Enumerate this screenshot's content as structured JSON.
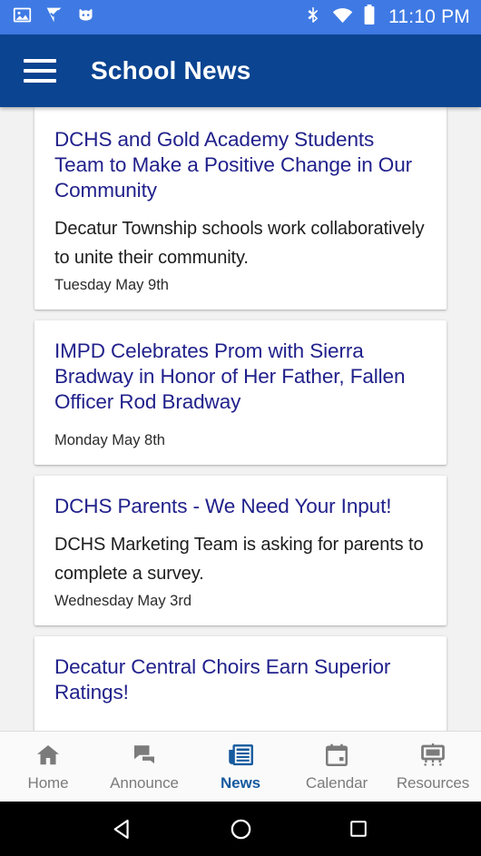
{
  "status_bar": {
    "background": "#3f7ae4",
    "clock": "11:10 PM",
    "left_icons": [
      {
        "name": "screenshot-image-icon"
      },
      {
        "name": "task-checkmark-icon"
      },
      {
        "name": "cyanogenmod-robot-icon"
      }
    ],
    "right_icons": [
      {
        "name": "bluetooth-icon"
      },
      {
        "name": "wifi-icon"
      },
      {
        "name": "battery-full-icon"
      }
    ]
  },
  "app_bar": {
    "background": "#0b4491",
    "title": "School News",
    "menu_icon": "hamburger-menu-icon"
  },
  "news": {
    "title_color": "#21218c",
    "cards": [
      {
        "title": "DCHS and Gold Academy Students Team to Make a Positive Change in Our Community",
        "summary": "Decatur Township schools work collaboratively to unite their community.",
        "date": "Tuesday May 9th"
      },
      {
        "title": "IMPD Celebrates Prom with Sierra Bradway in Honor of Her Father, Fallen Officer Rod Bradway",
        "summary": "",
        "date": "Monday May 8th"
      },
      {
        "title": "DCHS Parents - We Need Your Input!",
        "summary": "DCHS Marketing Team is asking for parents to complete a survey.",
        "date": "Wednesday May 3rd"
      },
      {
        "title": "Decatur Central Choirs Earn Superior Ratings!",
        "summary": "",
        "date": ""
      }
    ]
  },
  "tab_bar": {
    "active_color": "#165a9e",
    "inactive_color": "#7b7b7b",
    "tabs": [
      {
        "label": "Home",
        "icon": "home-icon",
        "active": false
      },
      {
        "label": "Announce",
        "icon": "speech-bubbles-icon",
        "active": false
      },
      {
        "label": "News",
        "icon": "newspaper-icon",
        "active": true
      },
      {
        "label": "Calendar",
        "icon": "calendar-icon",
        "active": false
      },
      {
        "label": "Resources",
        "icon": "easel-board-icon",
        "active": false
      }
    ]
  },
  "nav_bar": {
    "background": "#000000",
    "keys": [
      {
        "name": "back-button",
        "icon": "triangle-left-icon"
      },
      {
        "name": "home-button",
        "icon": "circle-icon"
      },
      {
        "name": "recents-button",
        "icon": "square-icon"
      }
    ]
  }
}
